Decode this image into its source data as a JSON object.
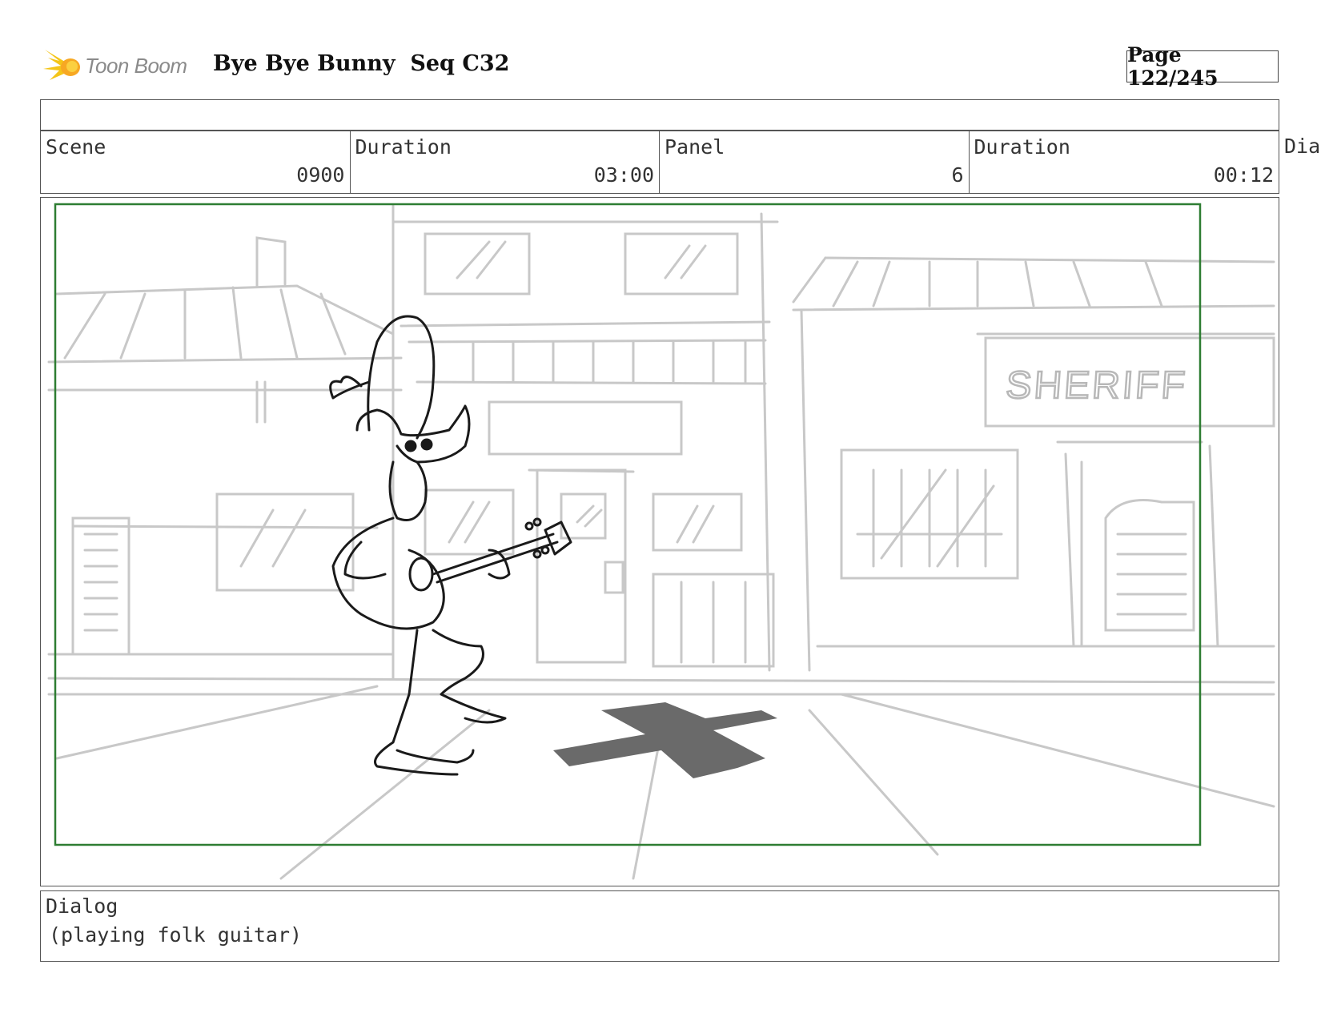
{
  "header": {
    "logo_text": "Toon Boom",
    "title": "Bye Bye Bunny  Seq C32",
    "page": "Page 122/245"
  },
  "info": {
    "scene_label": "Scene",
    "scene_value": "0900",
    "scene_duration_label": "Duration",
    "scene_duration_value": "03:00",
    "panel_label": "Panel",
    "panel_value": "6",
    "panel_duration_label": "Duration",
    "panel_duration_value": "00:12",
    "overflow_label": "Dia"
  },
  "panel": {
    "sign_text": "SHERIFF",
    "frame_color": "#2e7d32",
    "sketch_color": "#c8c8c8"
  },
  "dialog": {
    "label": "Dialog",
    "text": "(playing folk guitar)"
  }
}
